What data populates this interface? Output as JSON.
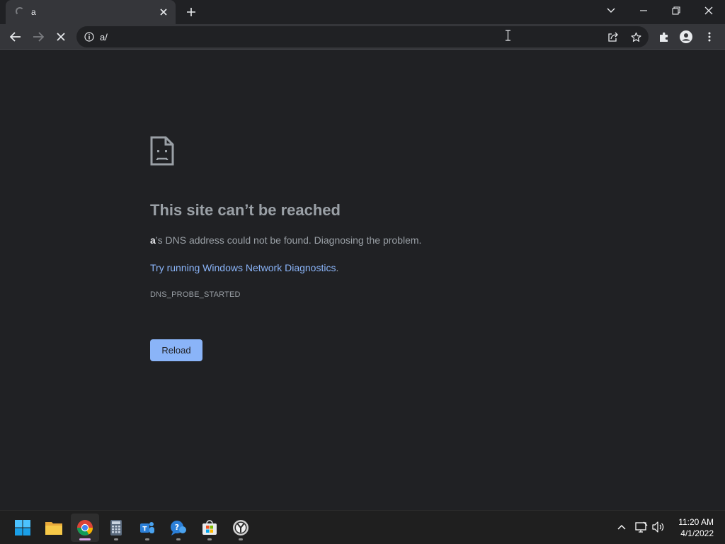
{
  "tab": {
    "title": "a"
  },
  "omnibox": {
    "url": "a/"
  },
  "error": {
    "title": "This site can’t be reached",
    "host": "a",
    "desc_rest": "’s DNS address could not be found. Diagnosing the problem.",
    "link_text": "Try running Windows Network Diagnostics",
    "link_suffix": ".",
    "code": "DNS_PROBE_STARTED",
    "reload_label": "Reload"
  },
  "taskbar": {
    "apps": [
      "start",
      "file-explorer",
      "chrome",
      "calculator",
      "teams",
      "get-help",
      "microsoft-store",
      "clock"
    ],
    "time": "11:20 AM",
    "date": "4/1/2022"
  },
  "colors": {
    "accent": "#8ab4f8",
    "page_bg": "#202124",
    "toolbar_bg": "#35363a"
  }
}
